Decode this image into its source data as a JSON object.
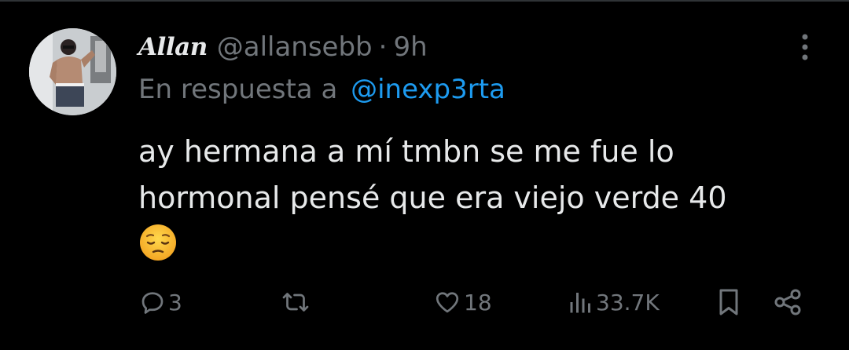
{
  "tweet": {
    "author": {
      "display_name": "Allan",
      "handle": "@allansebb",
      "avatar_icon": "avatar-photo"
    },
    "separator": "·",
    "time": "9h",
    "reply_to": {
      "prefix": "En respuesta a",
      "mention": "@inexp3rta"
    },
    "text_lines": [
      "ay hermana a mí tmbn se me fue lo",
      "hormonal pensé que era viejo verde 40"
    ],
    "emoji_icon": "pensive-face-icon"
  },
  "actions": {
    "reply_count": "3",
    "retweet_count": "",
    "like_count": "18",
    "views_count": "33.7K"
  },
  "colors": {
    "background": "#000000",
    "text_primary": "#e7e9ea",
    "text_secondary": "#71767b",
    "accent": "#1d9bf0",
    "divider": "#2f3336"
  }
}
